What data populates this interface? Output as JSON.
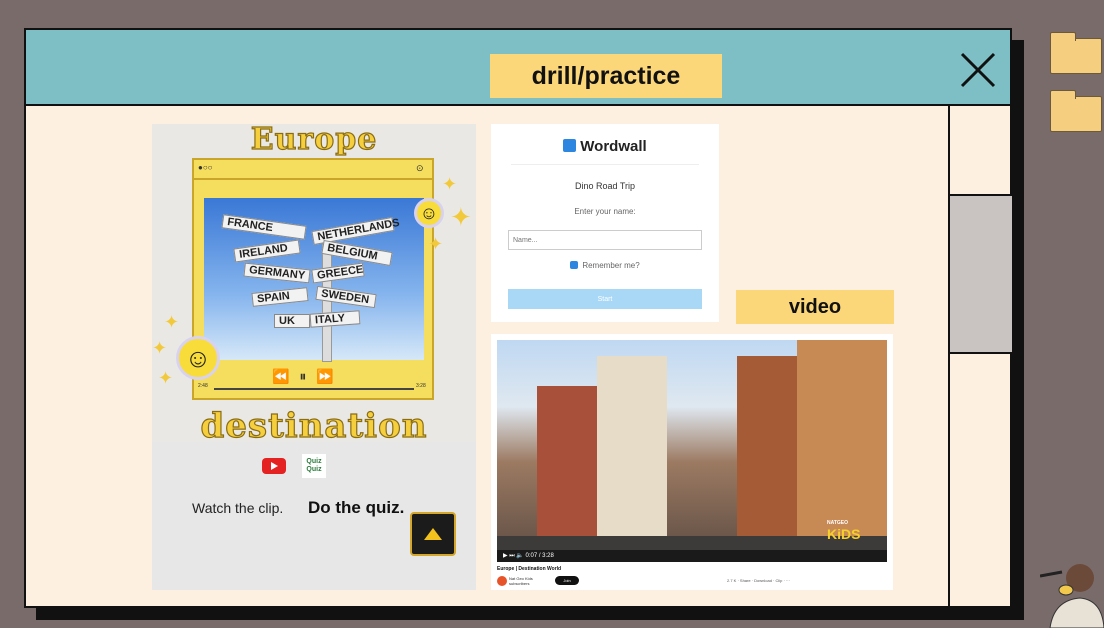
{
  "window": {
    "title": "drill/practice"
  },
  "poster": {
    "heading_top": "Europe",
    "heading_bottom": "destination",
    "signs": [
      "FRANCE",
      "NETHERLANDS",
      "IRELAND",
      "BELGIUM",
      "GERMANY",
      "GREECE",
      "SPAIN",
      "SWEDEN",
      "UK",
      "ITALY"
    ],
    "time_left": "2:48",
    "time_right": "3:28",
    "qq_label": "Quiz Quiz",
    "watch_text": "Watch the clip.",
    "quiz_text": "Do the quiz."
  },
  "wordwall": {
    "brand": "Wordwall",
    "game_title": "Dino Road Trip",
    "prompt": "Enter your name:",
    "name_placeholder": "Name...",
    "remember": "Remember me?",
    "start": "Start"
  },
  "video_label": "video",
  "video": {
    "time": "0:07 / 3:28",
    "brand_top": "NATGEO",
    "brand": "KiDS",
    "title": "Europe | Destination World",
    "channel": "Nat Geo Kids",
    "subscribers": "subscribers",
    "subscribe": "Join",
    "actions": "2.7 K  ·  Share  ·  Download  ·  Clip  ·  ···"
  },
  "colors": {
    "titlebar": "#7ebfc6",
    "label_bg": "#fbd77a",
    "window_bg": "#fdf0e1",
    "desk": "#7a6b6b"
  }
}
